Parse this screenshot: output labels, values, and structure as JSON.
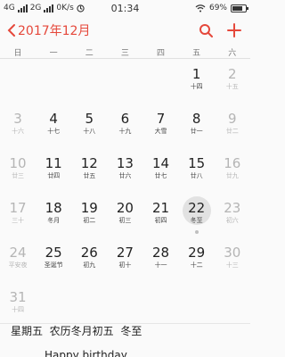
{
  "status": {
    "net1": "4G",
    "net2": "2G",
    "speed": "0K/s",
    "time": "01:34",
    "battery": "69%",
    "battery_level": 0.69
  },
  "header": {
    "title": "2017年12月"
  },
  "weekdays": [
    "日",
    "一",
    "二",
    "三",
    "四",
    "五",
    "六"
  ],
  "weeks": [
    [
      {
        "d": "",
        "l": ""
      },
      {
        "d": "",
        "l": ""
      },
      {
        "d": "",
        "l": ""
      },
      {
        "d": "",
        "l": ""
      },
      {
        "d": "",
        "l": ""
      },
      {
        "d": "1",
        "l": "十四"
      },
      {
        "d": "2",
        "l": "十五"
      }
    ],
    [
      {
        "d": "3",
        "l": "十六"
      },
      {
        "d": "4",
        "l": "十七"
      },
      {
        "d": "5",
        "l": "十八"
      },
      {
        "d": "6",
        "l": "十九"
      },
      {
        "d": "7",
        "l": "大雪"
      },
      {
        "d": "8",
        "l": "廿一"
      },
      {
        "d": "9",
        "l": "廿二"
      }
    ],
    [
      {
        "d": "10",
        "l": "廿三"
      },
      {
        "d": "11",
        "l": "廿四"
      },
      {
        "d": "12",
        "l": "廿五"
      },
      {
        "d": "13",
        "l": "廿六"
      },
      {
        "d": "14",
        "l": "廿七"
      },
      {
        "d": "15",
        "l": "廿八"
      },
      {
        "d": "16",
        "l": "廿九"
      }
    ],
    [
      {
        "d": "17",
        "l": "三十"
      },
      {
        "d": "18",
        "l": "冬月"
      },
      {
        "d": "19",
        "l": "初二"
      },
      {
        "d": "20",
        "l": "初三"
      },
      {
        "d": "21",
        "l": "初四"
      },
      {
        "d": "22",
        "l": "冬至"
      },
      {
        "d": "23",
        "l": "初六"
      }
    ],
    [
      {
        "d": "24",
        "l": "平安夜"
      },
      {
        "d": "25",
        "l": "圣诞节"
      },
      {
        "d": "26",
        "l": "初九"
      },
      {
        "d": "27",
        "l": "初十"
      },
      {
        "d": "28",
        "l": "十一"
      },
      {
        "d": "29",
        "l": "十二"
      },
      {
        "d": "30",
        "l": "十三"
      }
    ],
    [
      {
        "d": "31",
        "l": "十四"
      },
      {
        "d": "",
        "l": ""
      },
      {
        "d": "",
        "l": ""
      },
      {
        "d": "",
        "l": ""
      },
      {
        "d": "",
        "l": ""
      },
      {
        "d": "",
        "l": ""
      },
      {
        "d": "",
        "l": ""
      }
    ]
  ],
  "selected_day": "22",
  "detail": {
    "weekday": "星期五",
    "lunar": "农历冬月初五",
    "term": "冬至",
    "event": "Happy birthday"
  },
  "colors": {
    "accent": "#e5483b",
    "weekend_text": "#b5b5b5",
    "selected_bg": "#e2e2e2"
  }
}
